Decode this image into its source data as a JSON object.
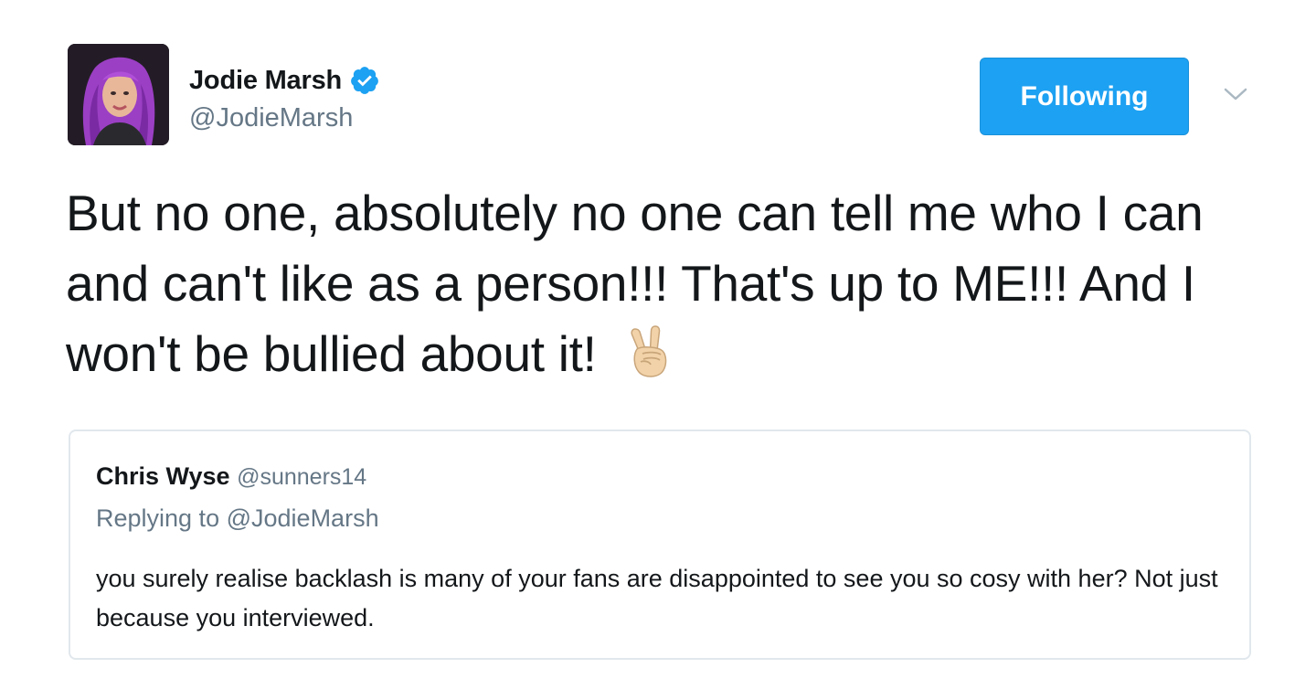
{
  "tweet": {
    "author": {
      "name": "Jodie Marsh",
      "handle": "@JodieMarsh",
      "verified": true
    },
    "follow_button_label": "Following",
    "text": "But no one, absolutely no one can tell me who I can and can't like as a person!!! That's up to ME!!! And I won't be bullied about it!",
    "emoji": "victory-hand-light-skin-tone",
    "quoted_tweet": {
      "name": "Chris Wyse",
      "handle": "@sunners14",
      "replying_prefix": "Replying to",
      "replying_to": "@JodieMarsh",
      "text": "you surely realise backlash is many of your fans are disappointed to see you so cosy with her? Not just because you interviewed."
    }
  },
  "colors": {
    "accent": "#1da1f2",
    "secondary_text": "#657786",
    "primary_text": "#14171a",
    "border": "#e1e8ed"
  }
}
